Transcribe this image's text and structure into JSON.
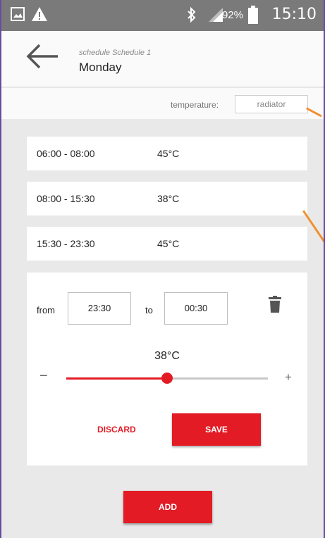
{
  "status_bar": {
    "battery_percent": "92%",
    "time": "15:10",
    "icons": [
      "image-icon",
      "warning-icon",
      "bluetooth-icon",
      "signal-icon",
      "battery-icon"
    ]
  },
  "header": {
    "subtitle": "schedule Schedule 1",
    "title": "Monday"
  },
  "temperature": {
    "label": "temperature:",
    "value": "radiator"
  },
  "schedule_rows": [
    {
      "range": "06:00 - 08:00",
      "temp": "45°C"
    },
    {
      "range": "08:00 - 15:30",
      "temp": "38°C"
    },
    {
      "range": "15:30 - 23:30",
      "temp": "45°C"
    }
  ],
  "editor": {
    "from_label": "from",
    "from_value": "23:30",
    "to_label": "to",
    "to_value": "00:30",
    "temperature_value": "38°C",
    "slider_level": 0.5,
    "minus": "−",
    "plus": "+",
    "discard_label": "DISCARD",
    "save_label": "SAVE"
  },
  "add_label": "ADD",
  "colors": {
    "accent": "#e21b24",
    "status_bar": "#7a7a7a",
    "annotation": "#f1902f"
  }
}
